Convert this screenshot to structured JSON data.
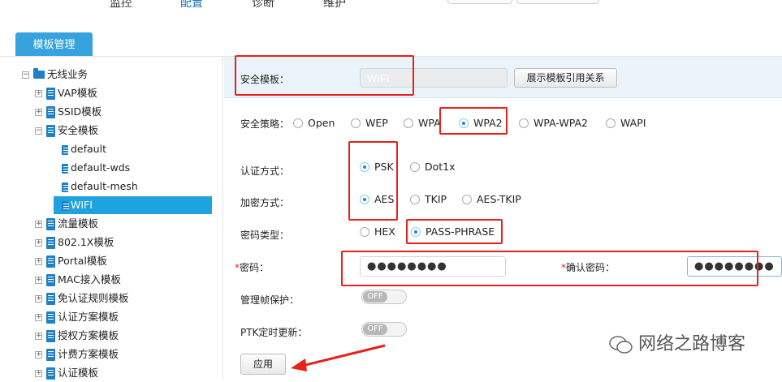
{
  "top_nav": [
    "监控",
    "配置",
    "诊断",
    "维护"
  ],
  "tab": "模板管理",
  "tree": {
    "root": "无线业务",
    "items": [
      {
        "label": "VAP模板",
        "level": 1,
        "expander": "+"
      },
      {
        "label": "SSID模板",
        "level": 1,
        "expander": "+"
      },
      {
        "label": "安全模板",
        "level": 1,
        "expander": "-"
      },
      {
        "label": "default",
        "level": 2
      },
      {
        "label": "default-wds",
        "level": 2
      },
      {
        "label": "default-mesh",
        "level": 2
      },
      {
        "label": "WIFI",
        "level": 2,
        "selected": true
      },
      {
        "label": "流量模板",
        "level": 1,
        "expander": "+"
      },
      {
        "label": "802.1X模板",
        "level": 1,
        "expander": "+"
      },
      {
        "label": "Portal模板",
        "level": 1,
        "expander": "+"
      },
      {
        "label": "MAC接入模板",
        "level": 1,
        "expander": "+"
      },
      {
        "label": "免认证规则模板",
        "level": 1,
        "expander": "+"
      },
      {
        "label": "认证方案模板",
        "level": 1,
        "expander": "+"
      },
      {
        "label": "授权方案模板",
        "level": 1,
        "expander": "+"
      },
      {
        "label": "计费方案模板",
        "level": 1,
        "expander": "+"
      },
      {
        "label": "认证模板",
        "level": 1,
        "expander": "+"
      }
    ]
  },
  "form": {
    "security_template_label": "安全模板：",
    "security_template_value": "WIFI",
    "show_refs_button": "展示模板引用关系",
    "policy_label": "安全策略：",
    "policy_options": [
      "Open",
      "WEP",
      "WPA",
      "WPA2",
      "WPA-WPA2",
      "WAPI"
    ],
    "policy_selected": "WPA2",
    "auth_label": "认证方式：",
    "auth_options": [
      "PSK",
      "Dot1x"
    ],
    "auth_selected": "PSK",
    "encrypt_label": "加密方式：",
    "encrypt_options": [
      "AES",
      "TKIP",
      "AES-TKIP"
    ],
    "encrypt_selected": "AES",
    "key_type_label": "密码类型：",
    "key_type_options": [
      "HEX",
      "PASS-PHRASE"
    ],
    "key_type_selected": "PASS-PHRASE",
    "password_label": "密码：",
    "password_value": "●●●●●●●●",
    "confirm_label": "确认密码：",
    "confirm_value": "●●●●●●●●",
    "required_mark": "*",
    "mgmt_protect_label": "管理帧保护：",
    "mgmt_protect_state": "OFF",
    "ptk_label": "PTK定时更新：",
    "ptk_state": "OFF",
    "apply_button": "应用"
  },
  "watermark": "网络之路博客",
  "colors": {
    "accent": "#36a3de",
    "selected": "#1fa3de",
    "highlight_box": "#e8211d",
    "radio_dot": "#1b8ad3"
  }
}
